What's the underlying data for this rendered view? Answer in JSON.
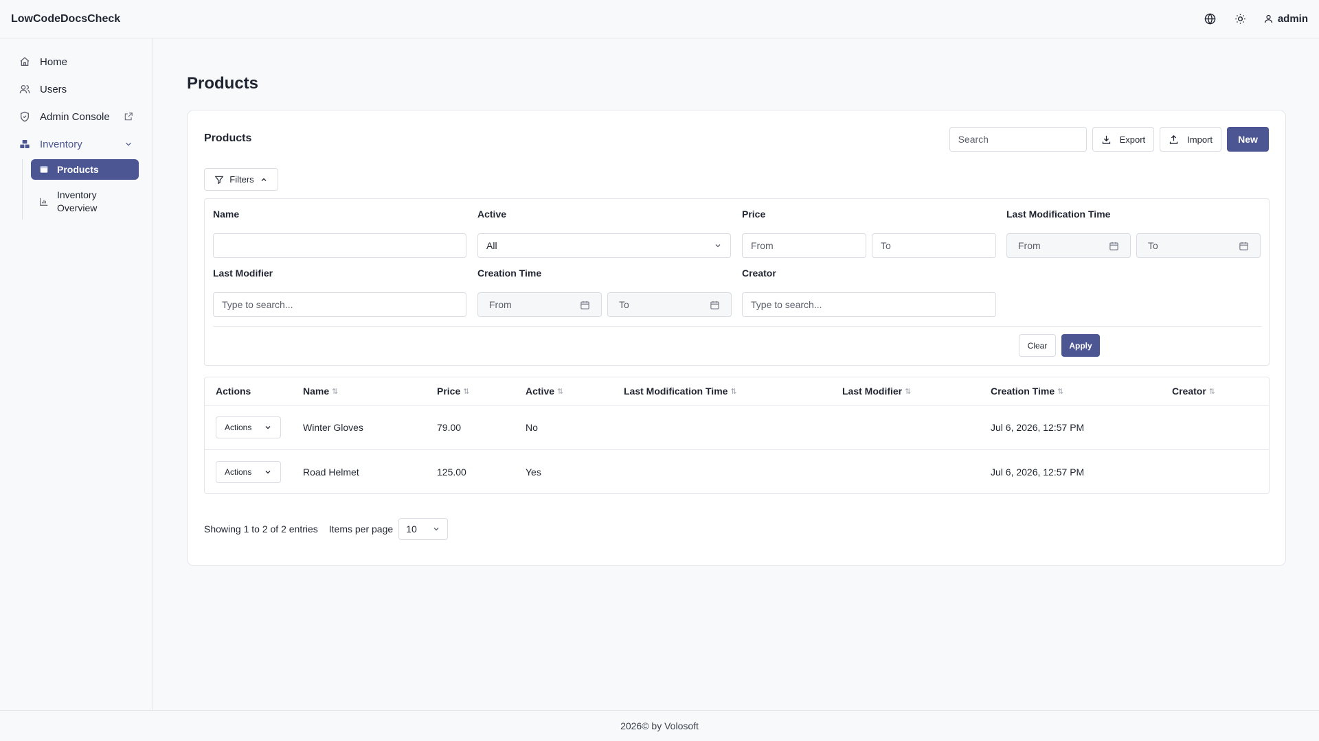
{
  "app": {
    "brand": "LowCodeDocsCheck",
    "user": "admin"
  },
  "sidebar": {
    "items": [
      {
        "label": "Home",
        "icon": "home-icon"
      },
      {
        "label": "Users",
        "icon": "users-icon"
      },
      {
        "label": "Admin Console",
        "icon": "shield-icon"
      },
      {
        "label": "Inventory",
        "icon": "inventory-icon"
      }
    ],
    "subitems": [
      {
        "label": "Products",
        "icon": "box-icon",
        "active": true
      },
      {
        "label": "Inventory Overview",
        "icon": "chart-icon",
        "active": false
      }
    ]
  },
  "page": {
    "title": "Products"
  },
  "card": {
    "title": "Products",
    "search_placeholder": "Search",
    "export_label": "Export",
    "import_label": "Import",
    "new_label": "New",
    "filters_label": "Filters"
  },
  "filters": {
    "name_label": "Name",
    "active_label": "Active",
    "active_value": "All",
    "price_label": "Price",
    "price_from": "From",
    "price_to": "To",
    "lmt_label": "Last Modification Time",
    "lmt_from": "From",
    "lmt_to": "To",
    "last_modifier_label": "Last Modifier",
    "last_modifier_placeholder": "Type to search...",
    "creation_time_label": "Creation Time",
    "ct_from": "From",
    "ct_to": "To",
    "creator_label": "Creator",
    "creator_placeholder": "Type to search...",
    "clear_label": "Clear",
    "apply_label": "Apply"
  },
  "table": {
    "headers": [
      "Actions",
      "Name",
      "Price",
      "Active",
      "Last Modification Time",
      "Last Modifier",
      "Creation Time",
      "Creator"
    ],
    "sort_glyph": "⇅",
    "actions_label": "Actions",
    "rows": [
      {
        "name": "Winter Gloves",
        "price": "79.00",
        "active": "No",
        "last_modification_time": "",
        "last_modifier": "",
        "creation_time": "Jul 6, 2026, 12:57 PM",
        "creator": ""
      },
      {
        "name": "Road Helmet",
        "price": "125.00",
        "active": "Yes",
        "last_modification_time": "",
        "last_modifier": "",
        "creation_time": "Jul 6, 2026, 12:57 PM",
        "creator": ""
      }
    ]
  },
  "pager": {
    "showing": "Showing 1 to 2 of 2 entries",
    "items_per_page_label": "Items per page",
    "items_per_page_value": "10"
  },
  "footer": {
    "text": "2026© by Volosoft"
  },
  "colors": {
    "primary": "#4c5692",
    "border": "#e4e6eb",
    "background": "#f8f9fb"
  }
}
